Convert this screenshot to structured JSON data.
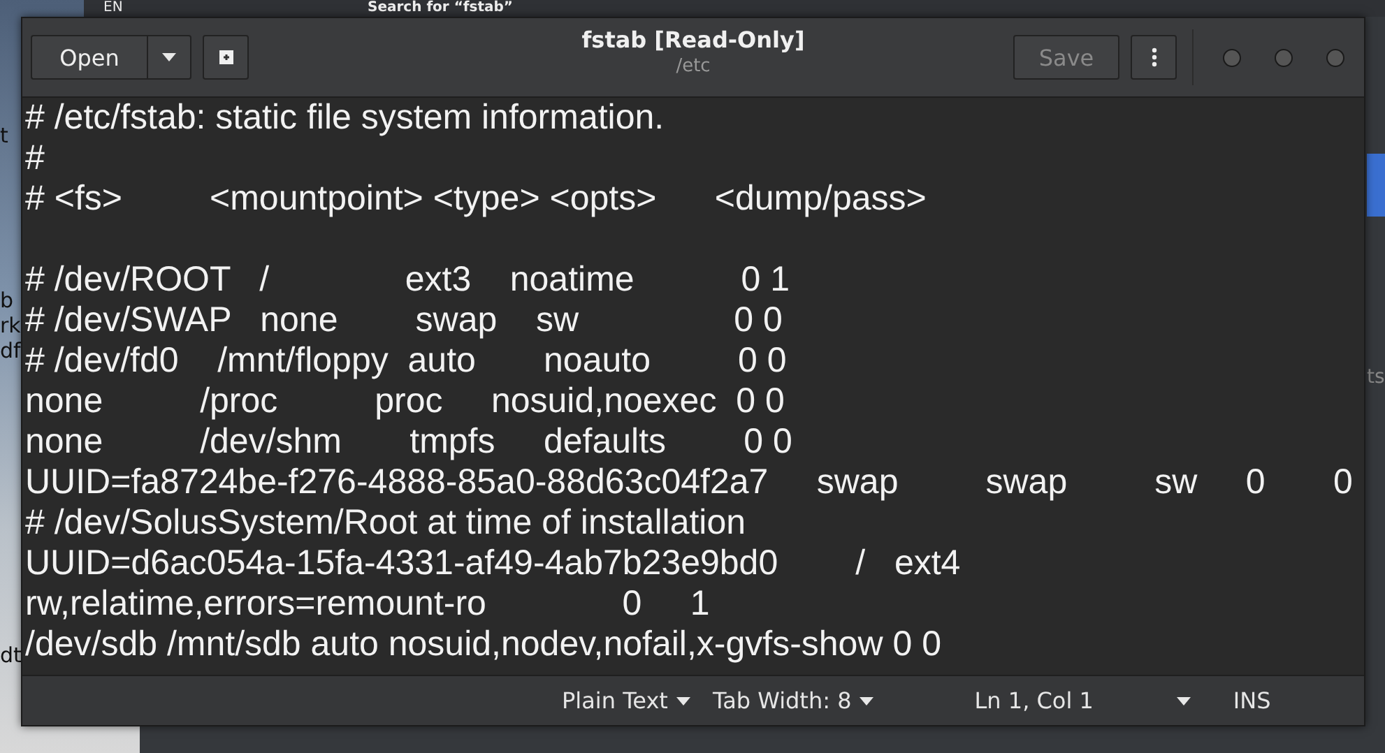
{
  "background": {
    "keyboard_layout": "EN",
    "search_title": "Search for “fstab”",
    "left_fragments": [
      "t",
      "b",
      "rk",
      "df",
      "dt"
    ],
    "right_fragment": "ts"
  },
  "window": {
    "title": "fstab [Read-Only]",
    "subtitle": "/etc"
  },
  "header": {
    "open_button": "Open",
    "save_button": {
      "label": "Save",
      "disabled": true
    }
  },
  "editor": {
    "lines": [
      {
        "kind": "text",
        "text": "# /etc/fstab: static file system information."
      },
      {
        "kind": "text",
        "text": "#"
      },
      {
        "kind": "text",
        "text": "# <fs>         <mountpoint> <type> <opts>      <dump/pass>"
      },
      {
        "kind": "blank"
      },
      {
        "kind": "text",
        "text": "# /dev/ROOT   /              ext3    noatime           0 1"
      },
      {
        "kind": "text",
        "text": "# /dev/SWAP   none        swap    sw                0 0"
      },
      {
        "kind": "text",
        "text": "# /dev/fd0    /mnt/floppy  auto       noauto         0 0"
      },
      {
        "kind": "text",
        "text": "none          /proc          proc     nosuid,noexec  0 0"
      },
      {
        "kind": "text",
        "text": "none          /dev/shm       tmpfs     defaults        0 0"
      },
      {
        "kind": "text",
        "text": "UUID=fa8724be-f276-4888-85a0-88d63c04f2a7     swap         swap         sw     0       0"
      },
      {
        "kind": "text",
        "text": "# /dev/SolusSystem/Root at time of installation"
      },
      {
        "kind": "text",
        "text": "UUID=d6ac054a-15fa-4331-af49-4ab7b23e9bd0        /   ext4"
      },
      {
        "kind": "text",
        "text": "rw,relatime,errors=remount-ro              0     1"
      },
      {
        "kind": "text",
        "text": "/dev/sdb /mnt/sdb auto nosuid,nodev,nofail,x-gvfs-show 0 0"
      }
    ]
  },
  "status_bar": {
    "language": "Plain Text",
    "tab_width": "Tab Width: 8",
    "position": "Ln 1, Col 1",
    "mode": "INS"
  }
}
